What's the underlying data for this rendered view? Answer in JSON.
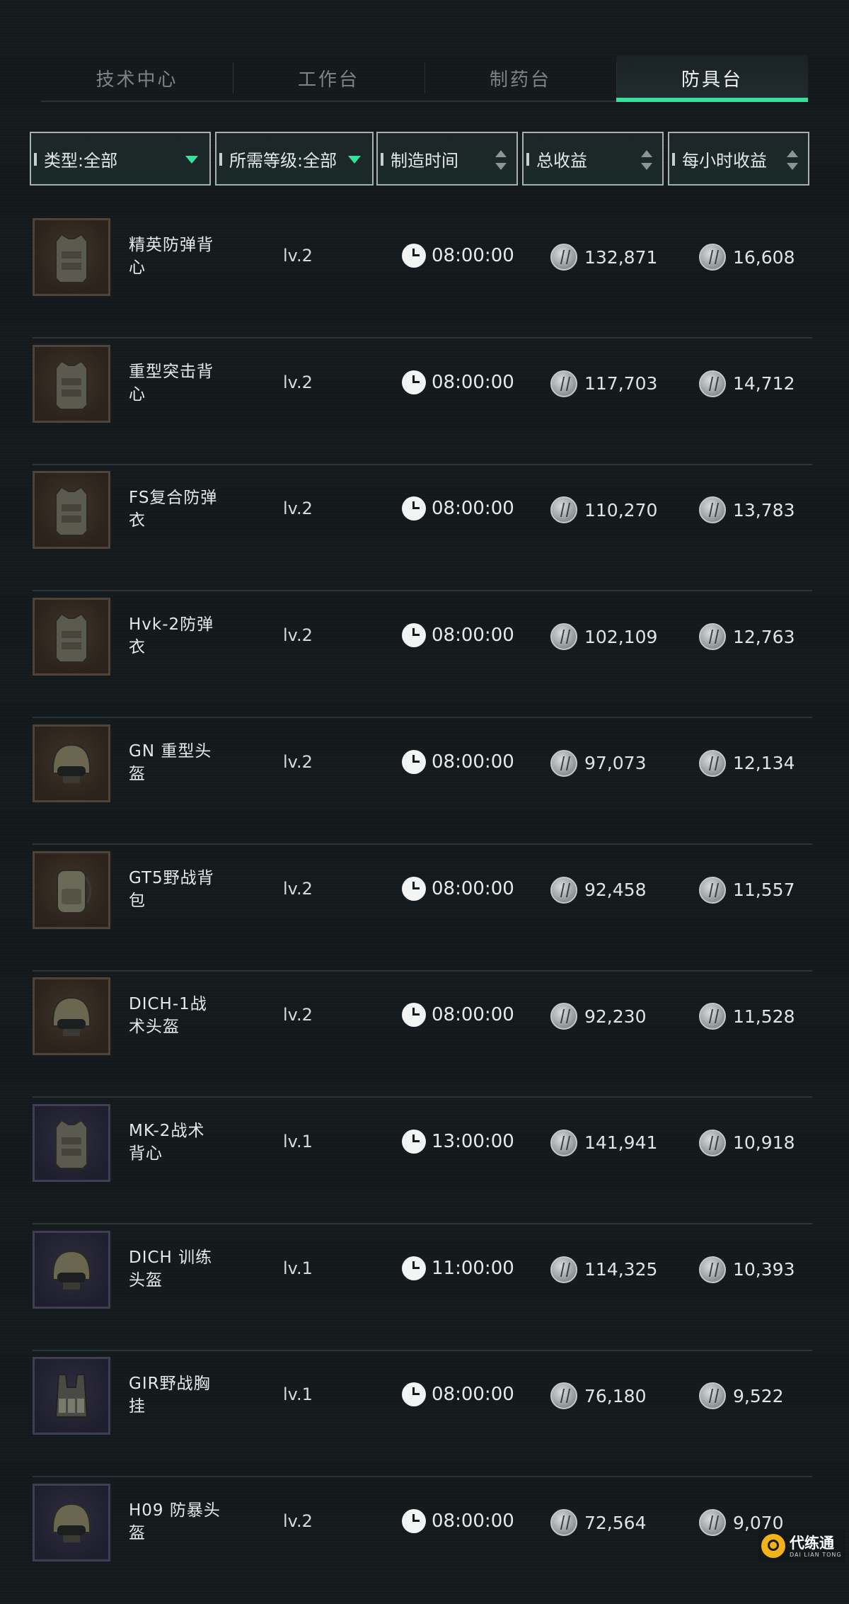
{
  "tabs": [
    {
      "label": "技术中心",
      "active": false
    },
    {
      "label": "工作台",
      "active": false
    },
    {
      "label": "制药台",
      "active": false
    },
    {
      "label": "防具台",
      "active": true
    }
  ],
  "filters": {
    "type": "类型:全部",
    "level": "所需等级:全部",
    "craft_time": "制造时间",
    "total_income": "总收益",
    "hourly_income": "每小时收益"
  },
  "items": [
    {
      "name": "精英防弹背心",
      "level": "lv.2",
      "time": "08:00:00",
      "total": "132,871",
      "hourly": "16,608",
      "icon": "vest-icon",
      "rarity": "gold"
    },
    {
      "name": "重型突击背心",
      "level": "lv.2",
      "time": "08:00:00",
      "total": "117,703",
      "hourly": "14,712",
      "icon": "vest-icon",
      "rarity": "gold"
    },
    {
      "name": "FS复合防弹衣",
      "level": "lv.2",
      "time": "08:00:00",
      "total": "110,270",
      "hourly": "13,783",
      "icon": "vest-icon",
      "rarity": "gold"
    },
    {
      "name": "Hvk-2防弹衣",
      "level": "lv.2",
      "time": "08:00:00",
      "total": "102,109",
      "hourly": "12,763",
      "icon": "vest-icon",
      "rarity": "gold"
    },
    {
      "name": "GN 重型头盔",
      "level": "lv.2",
      "time": "08:00:00",
      "total": "97,073",
      "hourly": "12,134",
      "icon": "helmet-icon",
      "rarity": "gold"
    },
    {
      "name": "GT5野战背包",
      "level": "lv.2",
      "time": "08:00:00",
      "total": "92,458",
      "hourly": "11,557",
      "icon": "backpack-icon",
      "rarity": "gold"
    },
    {
      "name": "DICH-1战术头盔",
      "level": "lv.2",
      "time": "08:00:00",
      "total": "92,230",
      "hourly": "11,528",
      "icon": "helmet-icon",
      "rarity": "gold"
    },
    {
      "name": "MK-2战术背心",
      "level": "lv.1",
      "time": "13:00:00",
      "total": "141,941",
      "hourly": "10,918",
      "icon": "vest-icon",
      "rarity": "purple"
    },
    {
      "name": "DICH 训练头盔",
      "level": "lv.1",
      "time": "11:00:00",
      "total": "114,325",
      "hourly": "10,393",
      "icon": "helmet-icon",
      "rarity": "purple"
    },
    {
      "name": "GIR野战胸挂",
      "level": "lv.1",
      "time": "08:00:00",
      "total": "76,180",
      "hourly": "9,522",
      "icon": "chest-rig-icon",
      "rarity": "purple"
    },
    {
      "name": "H09 防暴头盔",
      "level": "lv.2",
      "time": "08:00:00",
      "total": "72,564",
      "hourly": "9,070",
      "icon": "helmet-icon",
      "rarity": "purple"
    }
  ],
  "watermark": {
    "cn": "代练通",
    "en": "DAI LIAN TONG"
  },
  "colors": {
    "accent": "#34e29a",
    "background": "#14191c"
  }
}
